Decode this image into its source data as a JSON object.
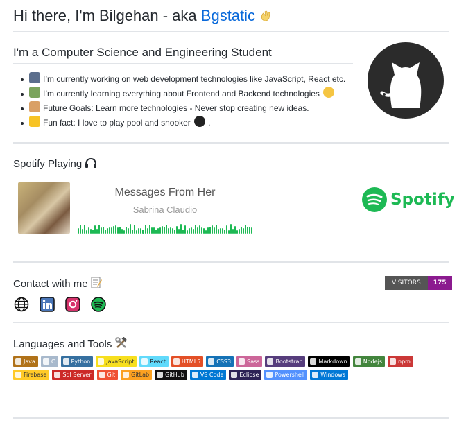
{
  "header": {
    "title_prefix": "Hi there, I'm Bilgehan - aka ",
    "title_link": "Bgstatic"
  },
  "intro": {
    "heading": "I'm a Computer Science and Engineering Student",
    "bullets": [
      "I’m currently working on web development technologies like JavaScript, React etc.",
      "I’m currently learning everything about Frontend and Backend technologies",
      "Future Goals: Learn more technologies - Never stop creating new ideas.",
      "Fun fact: I love to play pool and snooker"
    ]
  },
  "spotify": {
    "heading": "Spotify Playing",
    "song": "Messages From Her",
    "artist": "Sabrina Claudio",
    "brand": "Spotify"
  },
  "contact": {
    "heading": "Contact with me",
    "visitors_label": "VISITORS",
    "visitors_count": "175",
    "icons": [
      "globe-icon",
      "linkedin-icon",
      "instagram-icon",
      "spotify-icon"
    ]
  },
  "languages": {
    "heading": "Languages and Tools",
    "badges": [
      {
        "label": "Java",
        "color": "#b07219"
      },
      {
        "label": "C",
        "color": "#a8b9cc"
      },
      {
        "label": "Python",
        "color": "#3670a0"
      },
      {
        "label": "JavaScript",
        "color": "#f7df1e",
        "text": "#323330"
      },
      {
        "label": "React",
        "color": "#61dafb",
        "text": "#20232a"
      },
      {
        "label": "HTML5",
        "color": "#e34f26"
      },
      {
        "label": "CSS3",
        "color": "#1572b6"
      },
      {
        "label": "Sass",
        "color": "#cc6699"
      },
      {
        "label": "Bootstrap",
        "color": "#563d7c"
      },
      {
        "label": "Markdown",
        "color": "#000000"
      },
      {
        "label": "Nodejs",
        "color": "#43853d"
      },
      {
        "label": "npm",
        "color": "#cb3837"
      },
      {
        "label": "Firebase",
        "color": "#ffca28",
        "text": "#333333"
      },
      {
        "label": "Sql Server",
        "color": "#cc2927"
      },
      {
        "label": "Git",
        "color": "#f05033"
      },
      {
        "label": "GitLab",
        "color": "#fca121",
        "text": "#333333"
      },
      {
        "label": "GitHub",
        "color": "#121011"
      },
      {
        "label": "VS Code",
        "color": "#0078d4"
      },
      {
        "label": "Eclipse",
        "color": "#2c2255"
      },
      {
        "label": "Powershell",
        "color": "#5391fe"
      },
      {
        "label": "Windows",
        "color": "#0078d6"
      }
    ]
  },
  "colors": {
    "link": "#0969da",
    "spotify_green": "#1db954",
    "visitors_badge": "#8b1a8f"
  }
}
